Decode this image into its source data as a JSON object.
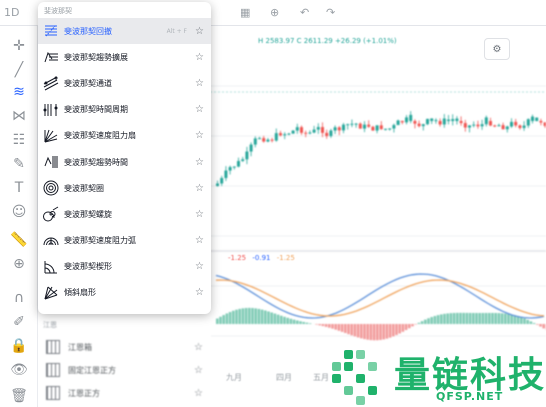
{
  "menu": {
    "header": "斐波那契",
    "items": [
      {
        "label": "斐波那契回撤",
        "icon": "fib-retracement-icon",
        "active": true,
        "hotkey": "Alt + F"
      },
      {
        "label": "斐波那契趨勢擴展",
        "icon": "fib-trend-extension-icon"
      },
      {
        "label": "斐波那契通道",
        "icon": "fib-channel-icon"
      },
      {
        "label": "斐波那契時間周期",
        "icon": "fib-time-zone-icon"
      },
      {
        "label": "斐波那契速度阻力扇",
        "icon": "fib-speed-fan-icon"
      },
      {
        "label": "斐波那契趨勢時間",
        "icon": "fib-trend-time-icon"
      },
      {
        "label": "斐波那契圈",
        "icon": "fib-circles-icon"
      },
      {
        "label": "斐波那契螺旋",
        "icon": "fib-spiral-icon"
      },
      {
        "label": "斐波那契速度阻力弧",
        "icon": "fib-speed-arcs-icon"
      },
      {
        "label": "斐波那契楔形",
        "icon": "fib-wedge-icon"
      },
      {
        "label": "傾斜扇形",
        "icon": "pitchfan-icon"
      }
    ]
  },
  "lower_menu": {
    "section": "江恩",
    "items": [
      {
        "label": "江恩箱"
      },
      {
        "label": "固定江恩正方"
      },
      {
        "label": "江恩正方"
      }
    ]
  },
  "chart": {
    "legend_top": "H 2583.97  C 2611.29 +26.29 (+1.01%)",
    "legend_macd": [
      "-1.25",
      "-0.91",
      "-1.25"
    ],
    "x_labels": [
      "九月",
      "四月",
      "五月"
    ]
  },
  "watermark": {
    "text": "量链科技",
    "sub": "QFSP.NET"
  },
  "colors": {
    "accent": "#2962ff",
    "up": "#26a69a",
    "down": "#ef5350",
    "watermark": "#1fb26b"
  }
}
